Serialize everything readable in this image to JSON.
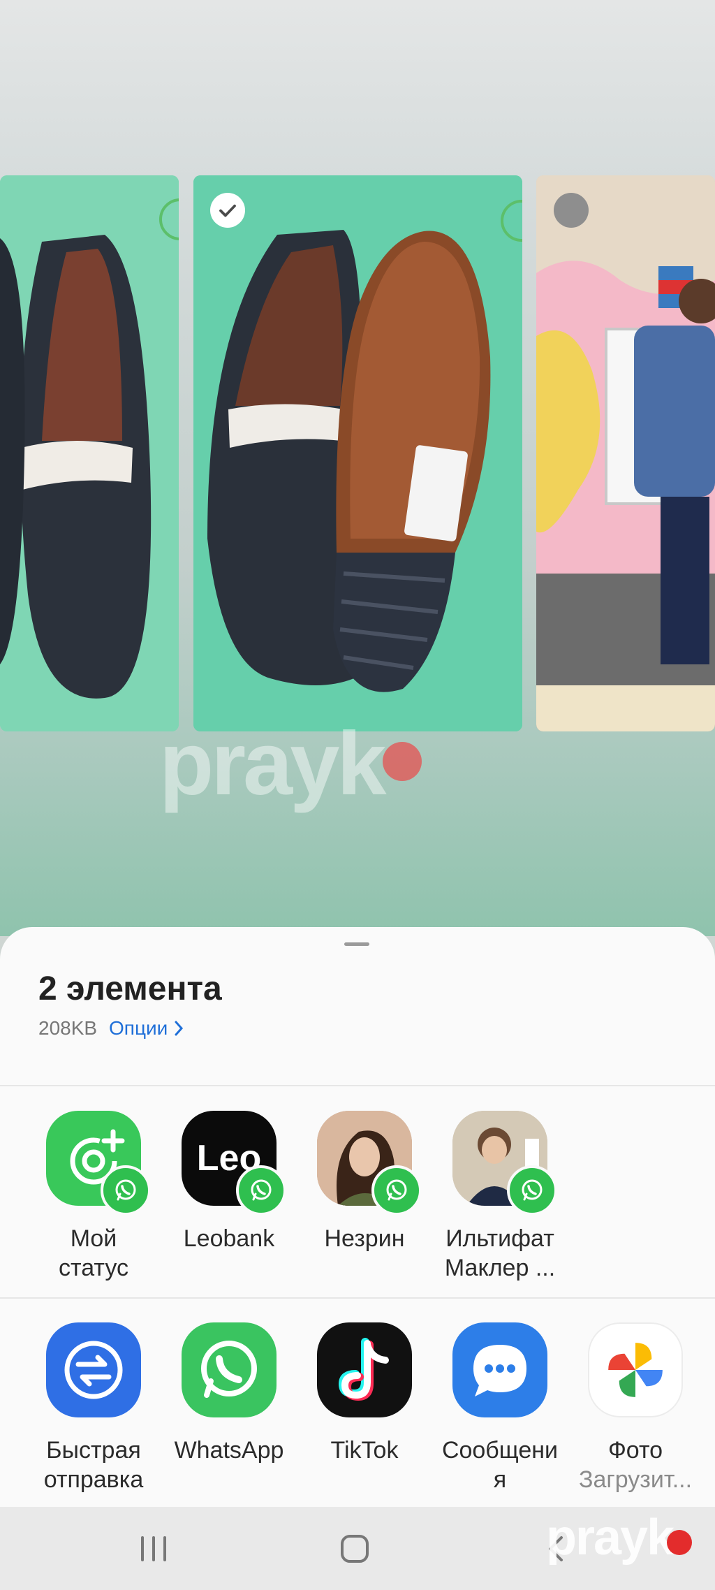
{
  "photos": [
    {
      "name": "shoe-top-view",
      "selected": null
    },
    {
      "name": "shoe-with-sole",
      "selected": true
    },
    {
      "name": "person-in-classroom",
      "selected": false
    }
  ],
  "watermark": "prayk",
  "sheet": {
    "title": "2 элемента",
    "size": "208KB",
    "options_label": "Опции"
  },
  "direct_share": [
    {
      "label_1": "Мой",
      "label_2": "статус"
    },
    {
      "label_1": "Leobank",
      "label_2": "",
      "logo_text": "Leo"
    },
    {
      "label_1": "Незрин",
      "label_2": ""
    },
    {
      "label_1": "Ильтифат",
      "label_2": "Маклер ..."
    }
  ],
  "apps": [
    {
      "label_1": "Быстрая",
      "label_2": "отправка"
    },
    {
      "label_1": "WhatsApp",
      "label_2": ""
    },
    {
      "label_1": "TikTok",
      "label_2": ""
    },
    {
      "label_1": "Сообщени",
      "label_2": "я"
    },
    {
      "label_1": "Фото",
      "label_2": "Загрузит..."
    }
  ],
  "colors": {
    "accent": "#1f6fd8",
    "whatsapp": "#2fbf4f",
    "sheet_bg": "#fafafa"
  }
}
